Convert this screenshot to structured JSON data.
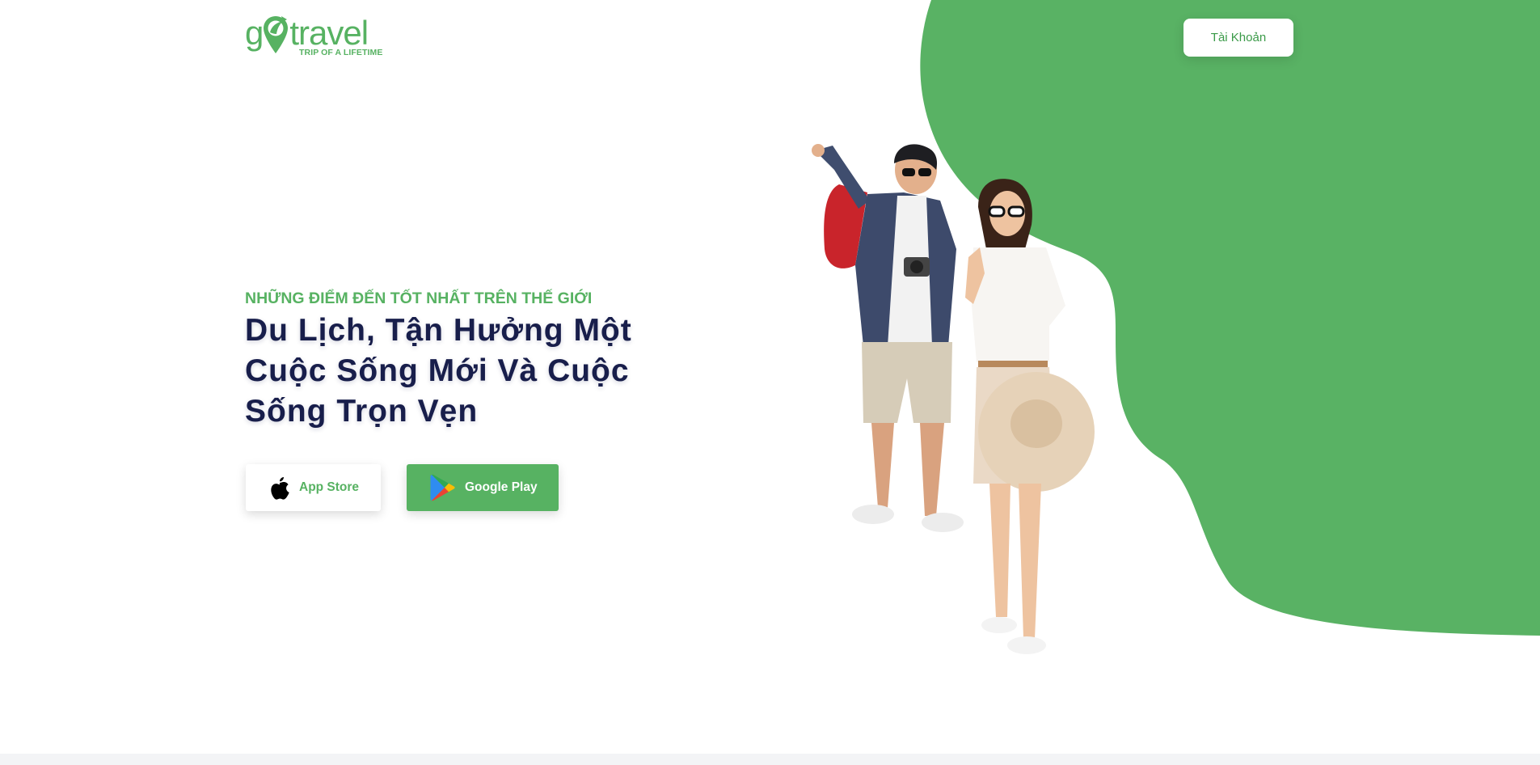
{
  "brand": {
    "logo_text_g": "g",
    "logo_text_rest": "travel",
    "tagline": "TRIP OF A LIFETIME",
    "color_primary": "#57b262",
    "color_heading": "#181e4b"
  },
  "header": {
    "account_label": "Tài Khoản"
  },
  "hero": {
    "subtitle": "NHỮNG ĐIỂM ĐẾN TỐT NHẤT TRÊN THẾ GIỚI",
    "headline_line1": "Du Lịch, Tận Hưởng Một",
    "headline_line2": "Cuộc Sống Mới Và Cuộc",
    "headline_line3": "Sống Trọn Vẹn",
    "image_icon": "travelers-illustration"
  },
  "downloads": {
    "app_store_label": "App Store",
    "app_store_icon": "apple-icon",
    "google_play_label": "Google Play",
    "google_play_icon": "google-play-icon"
  }
}
